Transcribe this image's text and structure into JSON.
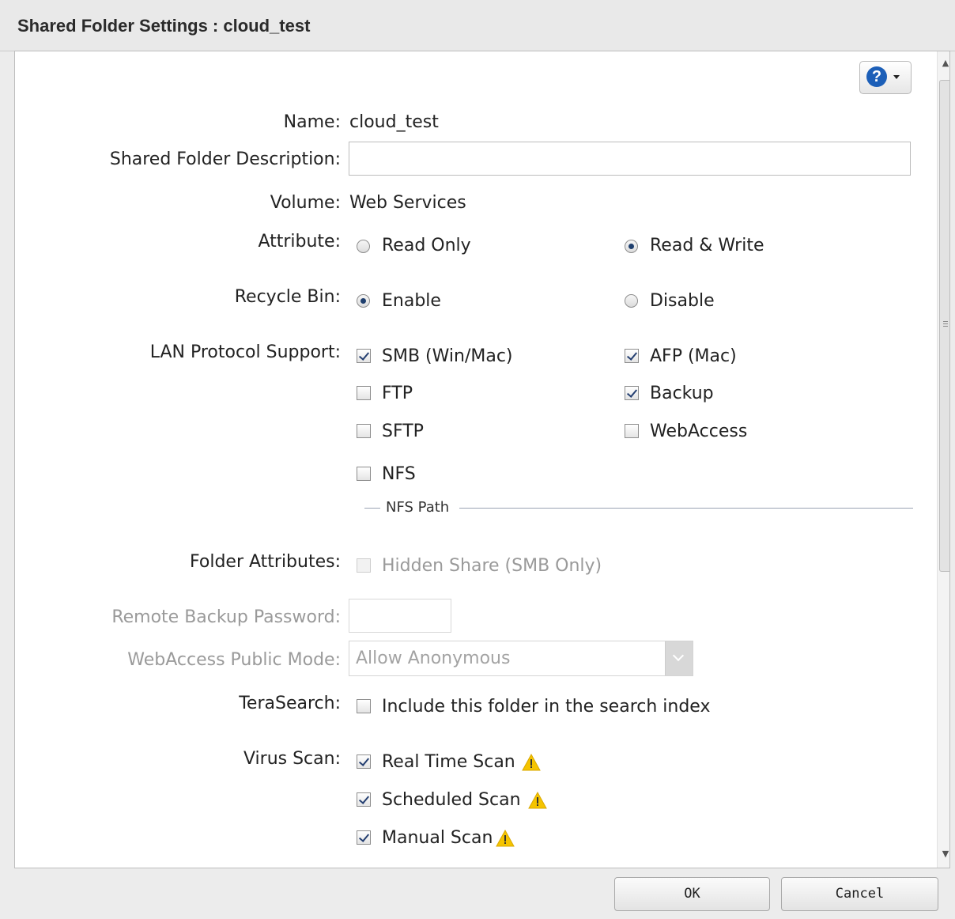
{
  "dialog": {
    "title": "Shared Folder Settings : cloud_test",
    "help_symbol": "?"
  },
  "form": {
    "name_label": "Name:",
    "name_value": "cloud_test",
    "description_label": "Shared Folder Description:",
    "description_value": "",
    "volume_label": "Volume:",
    "volume_value": "Web Services",
    "attribute_label": "Attribute:",
    "attribute_options": [
      "Read Only",
      "Read & Write"
    ],
    "attribute_selected": "Read & Write",
    "recycle_label": "Recycle Bin:",
    "recycle_options": [
      "Enable",
      "Disable"
    ],
    "recycle_selected": "Enable",
    "lan_label": "LAN Protocol Support:",
    "protocols": {
      "smb": {
        "label": "SMB (Win/Mac)",
        "checked": true
      },
      "afp": {
        "label": "AFP (Mac)",
        "checked": true
      },
      "ftp": {
        "label": "FTP",
        "checked": false
      },
      "backup": {
        "label": "Backup",
        "checked": true
      },
      "sftp": {
        "label": "SFTP",
        "checked": false
      },
      "webaccess": {
        "label": "WebAccess",
        "checked": false
      },
      "nfs": {
        "label": "NFS",
        "checked": false
      }
    },
    "nfs_path_label": "NFS Path",
    "folder_attr_label": "Folder Attributes:",
    "hidden_share_label": "Hidden Share (SMB Only)",
    "remote_backup_label": "Remote Backup Password:",
    "remote_backup_value": "",
    "webaccess_mode_label": "WebAccess Public Mode:",
    "webaccess_mode_value": "Allow Anonymous",
    "terasearch_label": "TeraSearch:",
    "terasearch_option": "Include this folder in the search index",
    "terasearch_checked": false,
    "virus_label": "Virus Scan:",
    "virus_options": {
      "realtime": {
        "label": "Real Time Scan",
        "checked": true
      },
      "scheduled": {
        "label": "Scheduled Scan",
        "checked": true
      },
      "manual": {
        "label": "Manual Scan",
        "checked": true
      }
    }
  },
  "footer": {
    "ok_label": "OK",
    "cancel_label": "Cancel"
  },
  "colors": {
    "help_icon": "#1c5fb8",
    "warning": "#f5c400",
    "checkmark": "#243f71"
  }
}
